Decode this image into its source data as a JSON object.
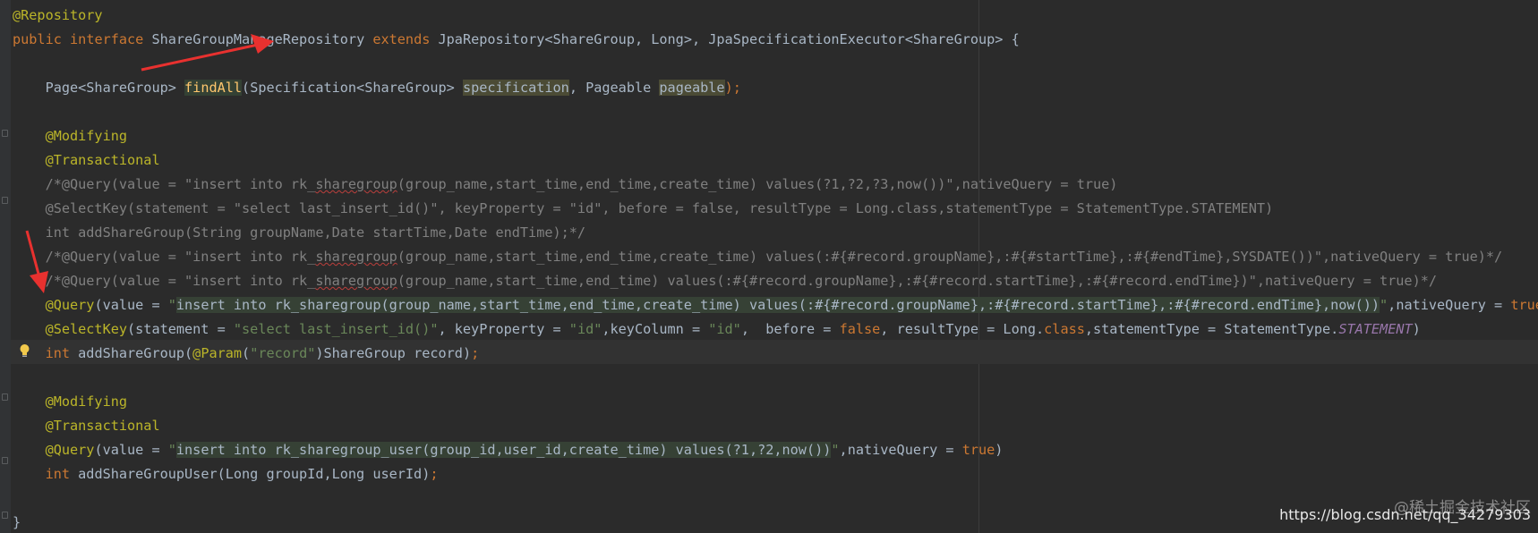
{
  "editor": {
    "lines": [
      [
        {
          "t": "@Repository",
          "c": "annotation"
        }
      ],
      [
        {
          "t": "public",
          "c": "keyword"
        },
        {
          "t": " ",
          "c": "plain"
        },
        {
          "t": "interface",
          "c": "keyword"
        },
        {
          "t": " ShareGroupManageRepository ",
          "c": "plain"
        },
        {
          "t": "extends",
          "c": "keyword"
        },
        {
          "t": " JpaRepository<ShareGroup, Long>, JpaSpecificationExecutor<ShareGroup> {",
          "c": "plain"
        }
      ],
      [],
      [
        {
          "t": "    Page<ShareGroup> ",
          "c": "plain"
        },
        {
          "t": "findAll",
          "c": "method hl-usage"
        },
        {
          "t": "(Specification<ShareGroup> ",
          "c": "plain"
        },
        {
          "t": "specification",
          "c": "plain hl-param"
        },
        {
          "t": ", Pageable ",
          "c": "plain"
        },
        {
          "t": "pageable",
          "c": "plain hl-param"
        },
        {
          "t": ");",
          "c": "keyword"
        }
      ],
      [],
      [
        {
          "t": "    @Modifying",
          "c": "annotation"
        }
      ],
      [
        {
          "t": "    @Transactional",
          "c": "annotation"
        }
      ],
      [
        {
          "t": "    /*@Query(value = \"insert into rk_",
          "c": "comment"
        },
        {
          "t": "sharegroup",
          "c": "comment squiggle"
        },
        {
          "t": "(group_name,start_time,end_time,create_time) values(?1,?2,?3,now())\",nativeQuery = true)",
          "c": "comment"
        }
      ],
      [
        {
          "t": "    @SelectKey(statement = \"select last_insert_id()\", keyProperty = \"id\", before = false, resultType = Long.class,statementType = StatementType.STATEMENT)",
          "c": "comment"
        }
      ],
      [
        {
          "t": "    int addShareGroup(String groupName,Date startTime,Date endTime);*/",
          "c": "comment"
        }
      ],
      [
        {
          "t": "    /*@Query(value = \"insert into rk_",
          "c": "comment"
        },
        {
          "t": "sharegroup",
          "c": "comment squiggle"
        },
        {
          "t": "(group_name,start_time,end_time,create_time) values(:#{#record.groupName},:#{#startTime},:#{#endTime},SYSDATE())\",nativeQuery = true)*/",
          "c": "comment"
        }
      ],
      [
        {
          "t": "    /*@Query(value = \"insert into rk_",
          "c": "comment"
        },
        {
          "t": "sharegroup",
          "c": "comment squiggle"
        },
        {
          "t": "(group_name,start_time,end_time) values(:#{#record.groupName},:#{#record.startTime},:#{#record.endTime})\",nativeQuery = true)*/",
          "c": "comment"
        }
      ],
      [
        {
          "t": "    @Query",
          "c": "annotation"
        },
        {
          "t": "(value = ",
          "c": "plain"
        },
        {
          "t": "\"",
          "c": "string"
        },
        {
          "t": "insert into rk_sharegroup(group_name,start_time,end_time,create_time) values(:#{#record.groupName},:#{#record.startTime},:#{#record.endTime},now())",
          "c": "plain hl-inject"
        },
        {
          "t": "\"",
          "c": "string"
        },
        {
          "t": ",nativeQuery = ",
          "c": "plain"
        },
        {
          "t": "true",
          "c": "keyword"
        },
        {
          "t": ")",
          "c": "plain"
        }
      ],
      [
        {
          "t": "    @SelectKey",
          "c": "annotation"
        },
        {
          "t": "(statement = ",
          "c": "plain"
        },
        {
          "t": "\"select last_insert_id()\"",
          "c": "string"
        },
        {
          "t": ", keyProperty = ",
          "c": "plain"
        },
        {
          "t": "\"id\"",
          "c": "string"
        },
        {
          "t": ",keyColumn = ",
          "c": "plain"
        },
        {
          "t": "\"id\"",
          "c": "string"
        },
        {
          "t": ",  before = ",
          "c": "plain"
        },
        {
          "t": "false",
          "c": "keyword"
        },
        {
          "t": ", resultType = Long.",
          "c": "plain"
        },
        {
          "t": "class",
          "c": "keyword"
        },
        {
          "t": ",statementType = StatementType.",
          "c": "plain"
        },
        {
          "t": "STATEMENT",
          "c": "static-field"
        },
        {
          "t": ")",
          "c": "plain"
        }
      ],
      [
        {
          "t": "    ",
          "c": "plain"
        },
        {
          "t": "int",
          "c": "keyword"
        },
        {
          "t": " addShareGroup(",
          "c": "plain"
        },
        {
          "t": "@Param",
          "c": "annotation"
        },
        {
          "t": "(",
          "c": "plain"
        },
        {
          "t": "\"record\"",
          "c": "string"
        },
        {
          "t": ")ShareGroup record)",
          "c": "plain"
        },
        {
          "t": ";",
          "c": "keyword"
        }
      ],
      [],
      [
        {
          "t": "    @Modifying",
          "c": "annotation"
        }
      ],
      [
        {
          "t": "    @Transactional",
          "c": "annotation"
        }
      ],
      [
        {
          "t": "    @Query",
          "c": "annotation"
        },
        {
          "t": "(value = ",
          "c": "plain"
        },
        {
          "t": "\"",
          "c": "string"
        },
        {
          "t": "insert into rk_sharegroup_user(group_id,user_id,create_time) values(?1,?2,now())",
          "c": "plain hl-inject"
        },
        {
          "t": "\"",
          "c": "string"
        },
        {
          "t": ",nativeQuery = ",
          "c": "plain"
        },
        {
          "t": "true",
          "c": "keyword"
        },
        {
          "t": ")",
          "c": "plain"
        }
      ],
      [
        {
          "t": "    ",
          "c": "plain"
        },
        {
          "t": "int",
          "c": "keyword"
        },
        {
          "t": " addShareGroupUser(Long groupId,Long userId)",
          "c": "plain"
        },
        {
          "t": ";",
          "c": "keyword"
        }
      ],
      [],
      [
        {
          "t": "}",
          "c": "plain"
        }
      ]
    ]
  },
  "watermark": {
    "top": "@稀土掘金技术社区",
    "bottom": "https://blog.csdn.net/qq_34279303"
  },
  "icons": {
    "intention_bulb": "lightbulb-icon",
    "annotation_arrows": "red-arrow-icon"
  },
  "colors": {
    "background": "#2b2b2b",
    "keyword": "#cc7832",
    "annotation": "#bbb529",
    "string": "#6a8759",
    "comment": "#808080",
    "arrow": "#e8312f"
  }
}
